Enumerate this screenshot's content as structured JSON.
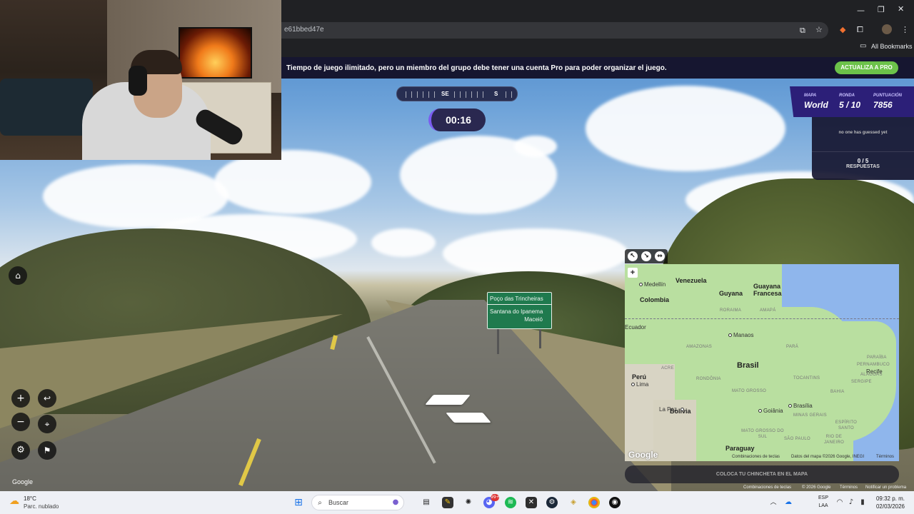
{
  "browser": {
    "url_fragment": "e61bbed47e",
    "bookmarks_label": "All Bookmarks"
  },
  "banner": {
    "text": "Tiempo de juego ilimitado, pero un miembro del grupo debe tener una cuenta Pro para poder organizar el juego.",
    "upgrade_label": "ACTUALIZA A PRO"
  },
  "compass": {
    "labels": [
      "SE",
      "S"
    ]
  },
  "timer": {
    "value": "00:16"
  },
  "scoreboard": {
    "map_label": "MAPA",
    "map_value": "World",
    "round_label": "RONDA",
    "round_value": "5 / 10",
    "score_label": "PUNTUACIÓN",
    "score_value": "7856"
  },
  "guesses": {
    "empty_text": "no one has guessed yet",
    "count": "0 / 5",
    "count_label": "RESPUESTAS"
  },
  "road_sign": {
    "line1": "Poço das Trincheiras",
    "line2": "Santana do Ipanema",
    "line3": "Maceió"
  },
  "map": {
    "countries": [
      "Venezuela",
      "Guyana",
      "Guayana Francesa",
      "Colombia",
      "Brasil",
      "Perú",
      "Bolivia",
      "Paraguay"
    ],
    "cities": [
      "Medellín",
      "Manaos",
      "Lima",
      "La Paz",
      "Brasília",
      "Goiânia",
      "Recife"
    ],
    "regions": [
      "RORAIMA",
      "AMAPÁ",
      "AMAZONAS",
      "PARÁ",
      "ACRE",
      "RONDÔNIA",
      "TOCANTINS",
      "BAHIA",
      "MATO GROSSO",
      "MATO GROSSO DO SUL",
      "MINAS GERAIS",
      "PARAÍBA",
      "PERNAMBUCO",
      "ALAGOAS",
      "SERGIPE",
      "ESPÍRITO SANTO",
      "SÃO PAULO",
      "RIO DE JANEIRO"
    ],
    "edge_label": "Ecuador",
    "google_logo": "Google",
    "attr_shortcuts": "Combinaciones de teclas",
    "attr_data": "Datos del mapa ©2026 Google, INEGI",
    "attr_terms": "Términos",
    "place_pin_label": "COLOCA TU CHINCHETA EN EL MAPA"
  },
  "streetview": {
    "google_watermark": "Google",
    "attr_shortcuts": "Combinaciones de teclas",
    "attr_copyright": "© 2026 Google",
    "attr_terms": "Términos",
    "attr_report": "Notificar un problema"
  },
  "taskbar": {
    "weather_temp": "18°C",
    "weather_desc": "Parc. nublado",
    "search_placeholder": "Buscar",
    "lang_1": "ESP",
    "lang_2": "LAA",
    "time": "09:32 p. m.",
    "date": "02/03/2026",
    "notification_count": "99+"
  }
}
